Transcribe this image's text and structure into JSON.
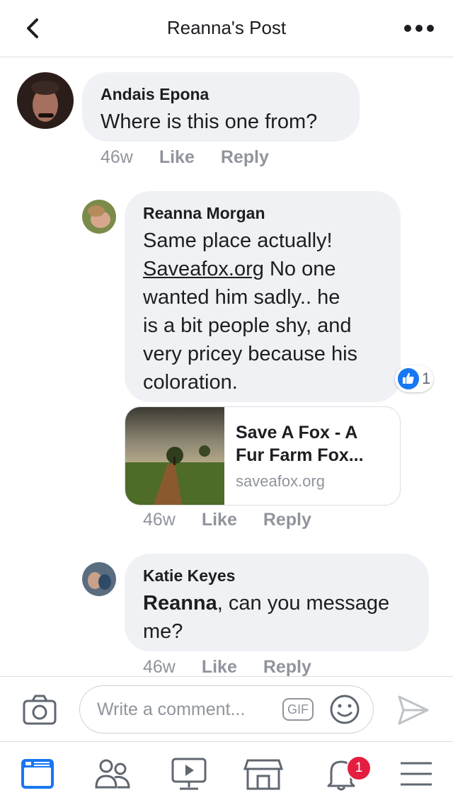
{
  "header": {
    "title": "Reanna's Post",
    "back_icon": "chevron-left-icon",
    "more_icon": "more-dots-icon"
  },
  "comments": [
    {
      "author": "Andais Epona",
      "text": "Where is this one from?",
      "time": "46w",
      "like_label": "Like",
      "reply_label": "Reply"
    },
    {
      "author": "Reanna Morgan",
      "text_line1": "Same place actually!",
      "link_text": "Saveafox.org",
      "text_rest_1": " No one",
      "text_line3": "wanted him sadly.. he",
      "text_line4": "is a bit people shy, and",
      "text_line5": "very pricey because his",
      "text_line6": "coloration.",
      "reaction_count": "1",
      "time": "46w",
      "like_label": "Like",
      "reply_label": "Reply",
      "link_preview": {
        "title_line1": "Save A Fox - A",
        "title_line2": "Fur Farm Fox...",
        "domain": "saveafox.org"
      }
    },
    {
      "author": "Katie Keyes",
      "mention": "Reanna",
      "text_after_mention": ", can you message",
      "text_line2": "me?",
      "time": "46w",
      "like_label": "Like",
      "reply_label": "Reply"
    }
  ],
  "composer": {
    "placeholder": "Write a comment...",
    "gif_label": "GIF"
  },
  "tabbar": {
    "items": [
      "news-feed-icon",
      "friends-icon",
      "watch-icon",
      "marketplace-icon",
      "notifications-icon",
      "menu-icon"
    ],
    "notification_count": "1"
  },
  "colors": {
    "accent": "#1877f2",
    "bubble": "#f0f1f4",
    "meta_text": "#90949c",
    "badge": "#e41e3f"
  }
}
